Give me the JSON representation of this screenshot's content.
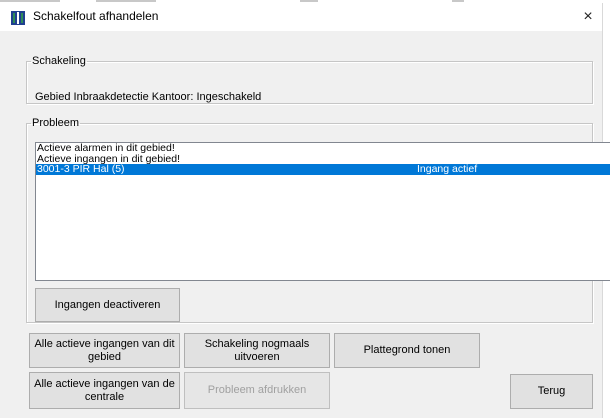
{
  "window": {
    "title": "Schakelfout afhandelen",
    "close_glyph": "×"
  },
  "schakeling": {
    "legend": "Schakeling",
    "status": "Gebied Inbraakdetectie Kantoor: Ingeschakeld"
  },
  "probleem": {
    "legend": "Probleem",
    "rows": [
      {
        "text": "Actieve alarmen in dit gebied!",
        "detail": "",
        "selected": false
      },
      {
        "text": "Actieve ingangen in dit gebied!",
        "detail": "",
        "selected": false
      },
      {
        "text": "3001-3 PIR Hal (5)",
        "detail": "Ingang actief",
        "selected": true
      }
    ],
    "deactivate_label": "Ingangen deactiveren"
  },
  "buttons": {
    "all_area_inputs": "Alle actieve ingangen van dit gebied",
    "rerun_switching": "Schakeling nogmaals uitvoeren",
    "show_floorplan": "Plattegrond tonen",
    "all_central_inputs": "Alle actieve ingangen van de centrale",
    "print_problem": "Probleem afdrukken",
    "back": "Terug"
  },
  "colors": {
    "selection": "#0078d7",
    "icon_green": "#2e8b57",
    "icon_blue": "#1f3f8f"
  }
}
